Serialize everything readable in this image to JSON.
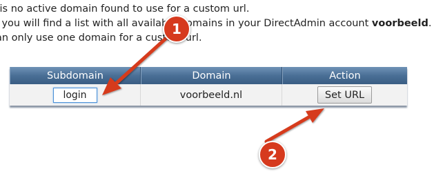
{
  "intro": {
    "line1": "e is no active domain found to use for a custom url.",
    "line2_prefix": "w you will find a list with all available domains in your DirectAdmin account ",
    "line2_account": "voorbeeld",
    "line2_suffix": ".",
    "line3": "can only use one domain for a custom url."
  },
  "table": {
    "headers": {
      "subdomain": "Subdomain",
      "domain": "Domain",
      "action": "Action"
    },
    "rows": [
      {
        "subdomain_value": "login",
        "domain": "voorbeeld.nl",
        "action_label": "Set URL"
      }
    ]
  },
  "annotations": {
    "badge1": "1",
    "badge2": "2",
    "color": "#d63a1e"
  },
  "colors": {
    "header_top": "#6f92b6",
    "header_bottom": "#3a5d83",
    "row_bg": "#f2f2f2"
  }
}
